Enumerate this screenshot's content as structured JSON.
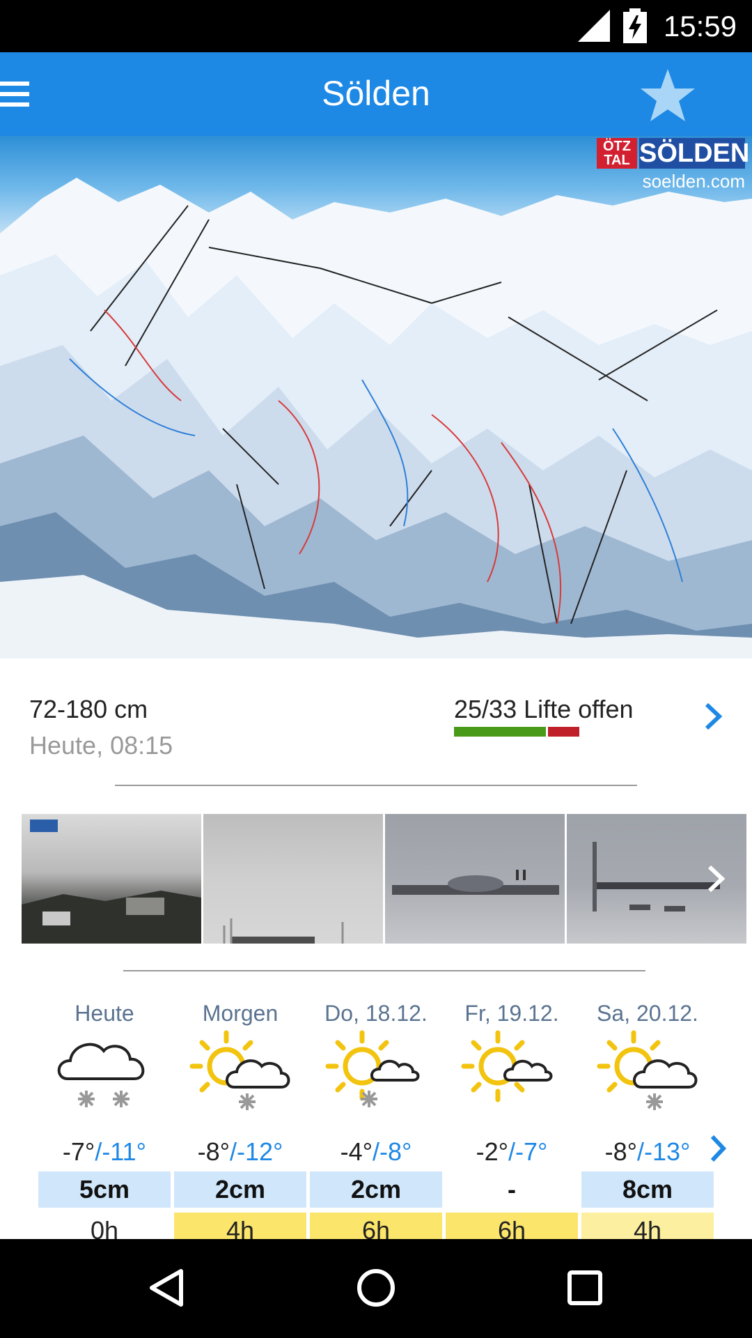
{
  "status_bar": {
    "time": "15:59"
  },
  "app_bar": {
    "title": "Sölden"
  },
  "map": {
    "logo_brand": "ÖTZ TAL",
    "logo_name": "SÖLDEN",
    "logo_url": "soelden.com"
  },
  "info": {
    "snow_depth": "72-180 cm",
    "updated": "Heute, 08:15",
    "lifts": "25/33 Lifte offen",
    "lifts_open": 25,
    "lifts_total": 33
  },
  "webcams": {
    "count": 4
  },
  "forecast": {
    "days": [
      {
        "label": "Heute",
        "icon": "cloud-snow-icon",
        "hi": "-7°",
        "lo": "/-11°",
        "snow": "5cm",
        "sun": "0h"
      },
      {
        "label": "Morgen",
        "icon": "sun-cloud-snow-icon",
        "hi": "-8°",
        "lo": "/-12°",
        "snow": "2cm",
        "sun": "4h"
      },
      {
        "label": "Do, 18.12.",
        "icon": "sun-cloud-snow-icon",
        "hi": "-4°",
        "lo": "/-8°",
        "snow": "2cm",
        "sun": "6h"
      },
      {
        "label": "Fr, 19.12.",
        "icon": "sun-cloud-icon",
        "hi": "-2°",
        "lo": "/-7°",
        "snow": "-",
        "sun": "6h"
      },
      {
        "label": "Sa, 20.12.",
        "icon": "sun-cloud-snow-icon",
        "hi": "-8°",
        "lo": "/-13°",
        "snow": "8cm",
        "sun": "4h"
      }
    ]
  },
  "colors": {
    "app_bar": "#1e88e5",
    "accent": "#1e88e5",
    "lifts_open": "#4a9a1a",
    "lifts_closed": "#c0202a",
    "snow_bg": "#cfe6fb",
    "sun_bg": "#fbe56a"
  }
}
